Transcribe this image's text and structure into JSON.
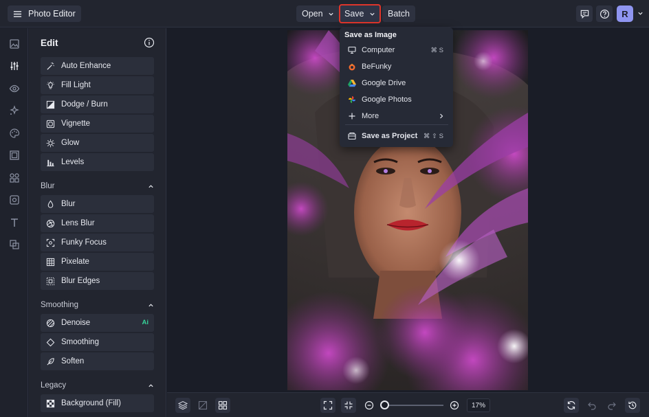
{
  "app": {
    "title": "Photo Editor"
  },
  "toolbar": {
    "open_label": "Open",
    "save_label": "Save",
    "batch_label": "Batch"
  },
  "user": {
    "initial": "R"
  },
  "panel": {
    "title": "Edit",
    "tools_main": [
      "Auto Enhance",
      "Fill Light",
      "Dodge / Burn",
      "Vignette",
      "Glow",
      "Levels"
    ],
    "sections": {
      "blur": {
        "label": "Blur",
        "items": [
          "Blur",
          "Lens Blur",
          "Funky Focus",
          "Pixelate",
          "Blur Edges"
        ]
      },
      "smoothing": {
        "label": "Smoothing",
        "items": [
          "Denoise",
          "Smoothing",
          "Soften"
        ],
        "ai_badge": "Ai"
      },
      "legacy": {
        "label": "Legacy",
        "items": [
          "Background (Fill)"
        ]
      }
    }
  },
  "save_menu": {
    "header": "Save as Image",
    "items": {
      "computer": "Computer",
      "computer_shortcut": "⌘ S",
      "befunky": "BeFunky",
      "google_drive": "Google Drive",
      "google_photos": "Google Photos",
      "more": "More",
      "save_project": "Save as Project",
      "save_project_shortcut": "⌘ ⇧ S"
    }
  },
  "zoom": {
    "value": "17%",
    "level_fraction": 0.0
  },
  "colors": {
    "accent": "#8f95f0",
    "highlight": "#e0352b",
    "ai": "#36d399"
  }
}
